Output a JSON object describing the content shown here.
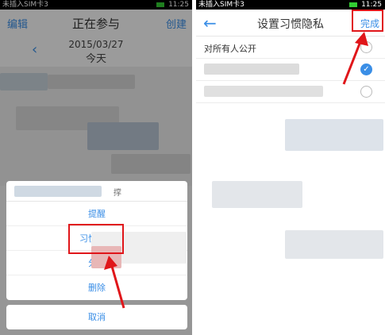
{
  "left": {
    "status": {
      "carrier": "未插入SIM卡3",
      "time": "11:25"
    },
    "header": {
      "edit": "编辑",
      "title": "正在参与",
      "create": "创建"
    },
    "date": {
      "prev_icon": "chevron-left-icon",
      "value": "2015/03/27",
      "label": "今天"
    },
    "sheet": {
      "header_text": "撑",
      "items": [
        "提醒",
        "习惯隐私",
        "分享",
        "删除"
      ],
      "cancel": "取消"
    }
  },
  "right": {
    "status": {
      "carrier": "未插入SIM卡3",
      "time": "11:25"
    },
    "header": {
      "back_icon": "arrow-left-icon",
      "title": "设置习惯隐私",
      "done": "完成"
    },
    "options": [
      {
        "label": "对所有人公开",
        "checked": false
      }
    ]
  },
  "colors": {
    "accent": "#3a8ee6",
    "highlight": "#e0161a"
  }
}
